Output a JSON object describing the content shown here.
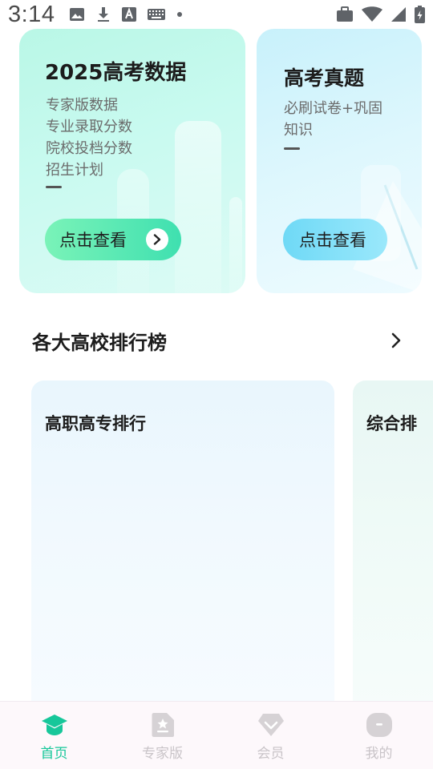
{
  "status_bar": {
    "time": "3:14",
    "icons_left": [
      "image-icon",
      "download-icon",
      "font-icon",
      "keyboard-icon",
      "dot-icon"
    ],
    "icons_right": [
      "briefcase-icon",
      "wifi-icon",
      "signal-icon",
      "battery-icon"
    ]
  },
  "cards": {
    "data": {
      "title": "2025高考数据",
      "lines": [
        "专家版数据",
        "专业录取分数",
        "院校投档分数",
        "招生计划"
      ],
      "button": "点击查看"
    },
    "exam": {
      "title": "高考真题",
      "lines": [
        "必刷试卷+巩固",
        "知识"
      ],
      "button": "点击查看"
    }
  },
  "ranking": {
    "title": "各大高校排行榜",
    "cards": [
      {
        "title": "高职高专排行"
      },
      {
        "title": "综合排"
      }
    ]
  },
  "bottom_nav": {
    "items": [
      {
        "label": "首页",
        "active": true
      },
      {
        "label": "专家版",
        "active": false
      },
      {
        "label": "会员",
        "active": false
      },
      {
        "label": "我的",
        "active": false
      }
    ]
  },
  "colors": {
    "accent": "#17c79a",
    "inactive": "#c9c4c8",
    "card_data_bg": "#c9faf0",
    "card_exam_bg": "#def7fd"
  }
}
